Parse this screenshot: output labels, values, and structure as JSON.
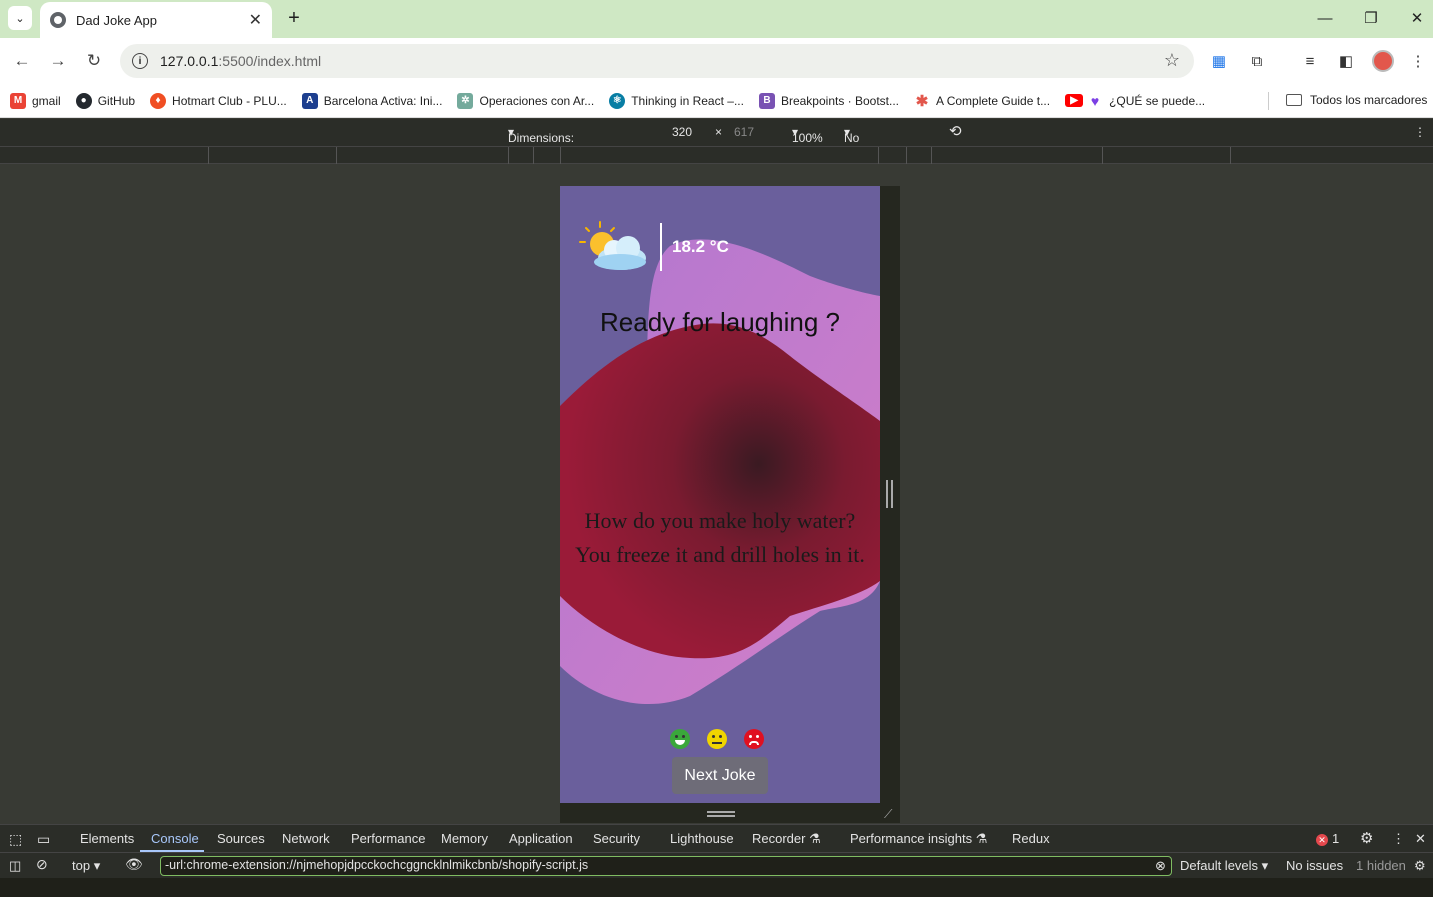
{
  "browser": {
    "tab_title": "Dad Joke App",
    "url_host": "127.0.0.1",
    "url_path": ":5500/index.html",
    "bookmarks": [
      {
        "label": "gmail",
        "icon": "gmail-icon",
        "color": "#ea4335"
      },
      {
        "label": "GitHub",
        "icon": "github-icon",
        "color": "#24292f"
      },
      {
        "label": "Hotmart Club - PLU...",
        "icon": "hotmart-icon",
        "color": "#f04e23"
      },
      {
        "label": "Barcelona Activa: Ini...",
        "icon": "barcelona-activa-icon",
        "color": "#1d3f8f"
      },
      {
        "label": "Operaciones con Ar...",
        "icon": "chatgpt-icon",
        "color": "#74aa9c"
      },
      {
        "label": "Thinking in React –...",
        "icon": "react-icon",
        "color": "#087ea4"
      },
      {
        "label": "Breakpoints · Bootst...",
        "icon": "bootstrap-icon",
        "color": "#7952b3"
      },
      {
        "label": "A Complete Guide t...",
        "icon": "asterisk-icon",
        "color": "#e2574c"
      },
      {
        "label": "¿QUÉ se puede...",
        "icon": "youtube-icon",
        "color": "#ff0000"
      }
    ],
    "all_bookmarks_label": "Todos los marcadores"
  },
  "device_toolbar": {
    "dimensions_label": "Dimensions: Responsive",
    "width": "320",
    "times": "×",
    "height": "617",
    "zoom": "100%",
    "throttling": "No throttling"
  },
  "app": {
    "temperature": "18.2 °C",
    "title": "Ready for laughing ?",
    "joke_line1": "How do you make holy water?",
    "joke_line2": "You freeze it and drill holes in it.",
    "next_button": "Next Joke",
    "colors": {
      "background": "#6a5f9c",
      "blob_red": "#8b1a35",
      "blob_pink": "#c07dd0",
      "face_happy": "#3aa83a",
      "face_neutral": "#f0d400",
      "face_angry": "#e01020"
    }
  },
  "devtools": {
    "tabs": [
      "Elements",
      "Console",
      "Sources",
      "Network",
      "Performance",
      "Memory",
      "Application",
      "Security",
      "Lighthouse",
      "Recorder",
      "Performance insights",
      "Redux"
    ],
    "active_tab": "Console",
    "error_count": "1",
    "context": "top",
    "filter_text": "-url:chrome-extension://njmehopjdpcckochcggncklnlmikcbnb/shopify-script.js",
    "levels": "Default levels",
    "issues": "No issues",
    "hidden": "1 hidden"
  }
}
